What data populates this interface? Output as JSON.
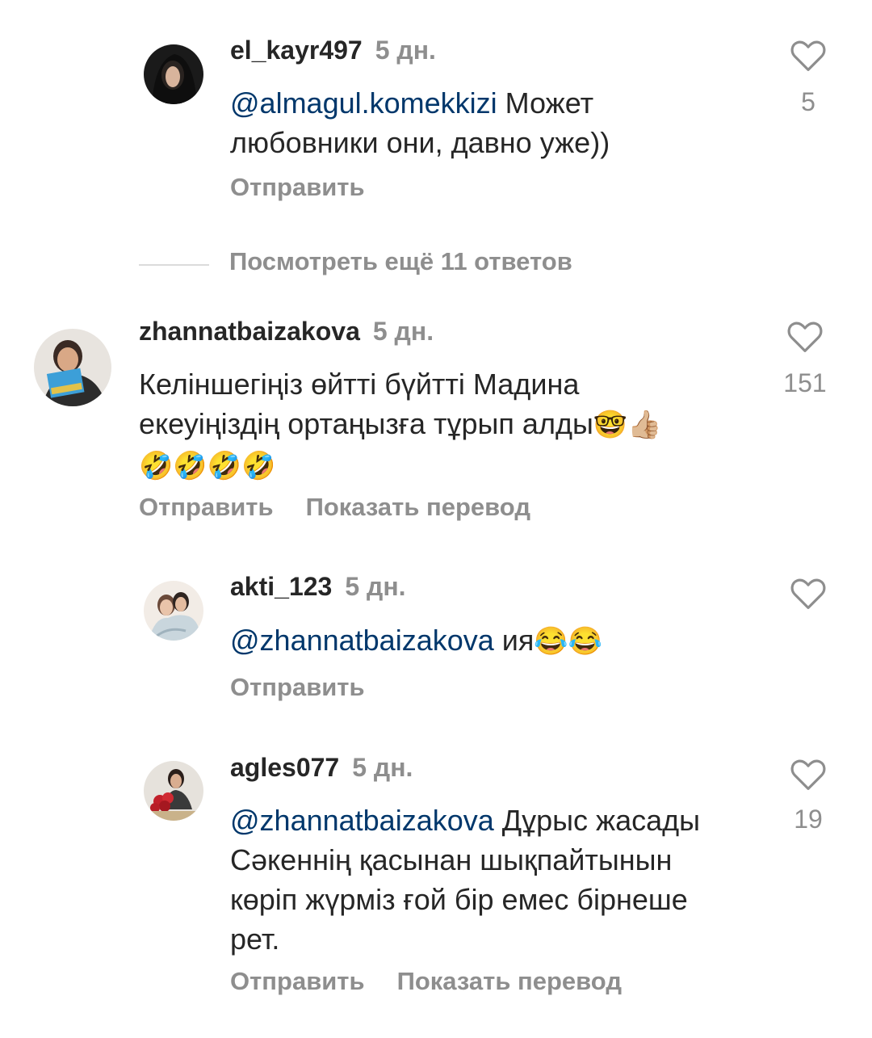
{
  "colors": {
    "text": "#262626",
    "secondary": "#8e8e8e",
    "mention": "#00376b",
    "divider": "#dbdbdb"
  },
  "comments": [
    {
      "username": "el_kayr497",
      "time": "5 дн.",
      "mention": "@almagul.komekkizi",
      "text_line1": " Может",
      "text_line2": "любовники они, давно уже))",
      "likes": "5",
      "reply_label": "Отправить"
    },
    {
      "username": "zhannatbaizakova",
      "time": "5 дн.",
      "text_line1": "Келіншегіңіз өйтті бүйтті Мадина",
      "text_line2": "екеуіңіздің ортаңызға тұрып алды",
      "emoji_line2": "🤓👍🏼",
      "emoji_line3": "🤣🤣🤣🤣",
      "likes": "151",
      "reply_label": "Отправить",
      "translate_label": "Показать перевод"
    },
    {
      "username": "akti_123",
      "time": "5 дн.",
      "mention": "@zhannatbaizakova",
      "text_line1": " ия",
      "emoji_line1": "😂😂",
      "reply_label": "Отправить"
    },
    {
      "username": "agles077",
      "time": "5 дн.",
      "mention": "@zhannatbaizakova",
      "text_line1": " Дұрыс жасады",
      "text_line2": "Сәкеннің қасынан шықпайтынын",
      "text_line3": "көріп жүрміз ғой бір емес бірнеше",
      "text_line4": "рет.",
      "likes": "19",
      "reply_label": "Отправить",
      "translate_label": "Показать перевод"
    }
  ],
  "more_replies": "Посмотреть ещё 11 ответов",
  "icons": {
    "like": "heart-outline-icon"
  }
}
